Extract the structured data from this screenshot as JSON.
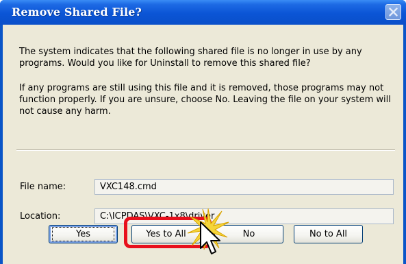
{
  "window": {
    "title": "Remove Shared File?"
  },
  "message": {
    "paragraph1": "The system indicates that the following shared file is no longer in use by any programs. Would you like for Uninstall to remove this shared file?",
    "paragraph2": "If any programs are still using this file and it is removed, those programs may not function properly. If you are unsure, choose No. Leaving the file on your system will not cause any harm."
  },
  "fields": {
    "file_name_label": "File name:",
    "file_name_value": "VXC148.cmd",
    "location_label": "Location:",
    "location_value": "C:\\ICPDAS\\VXC-1x8\\driver"
  },
  "buttons": {
    "yes": "Yes",
    "yes_to_all": "Yes to All",
    "no": "No",
    "no_to_all": "No to All"
  },
  "colors": {
    "titlebar": "#0a55d6",
    "dialog_background": "#ece9d8",
    "highlight_ring": "#e8101c",
    "click_burst": "#f5d53a"
  },
  "icons": {
    "close": "close-icon",
    "cursor": "mouse-pointer-icon",
    "burst": "click-burst-icon"
  }
}
